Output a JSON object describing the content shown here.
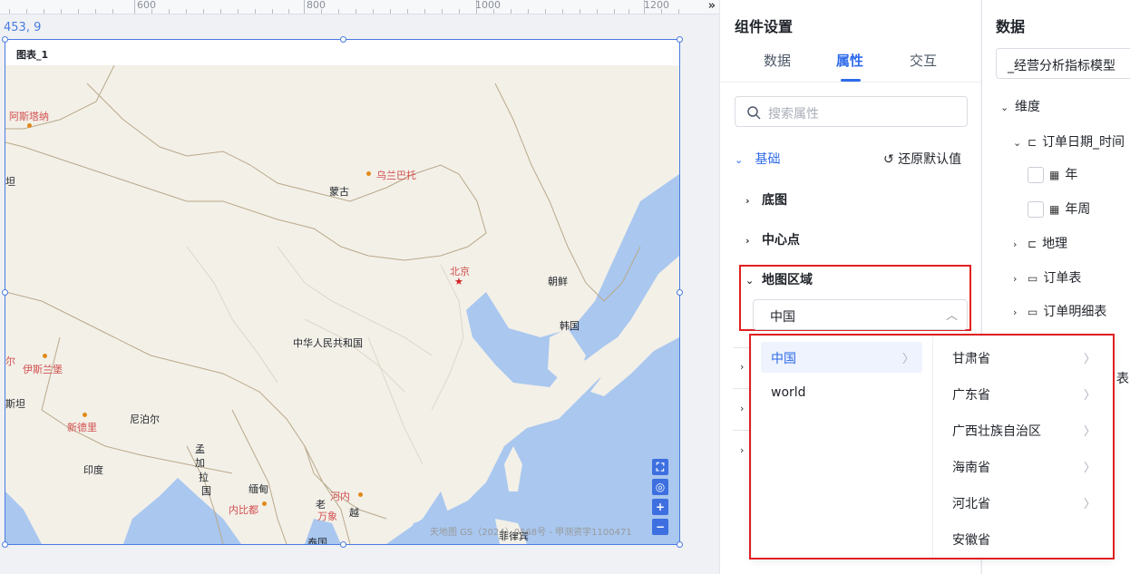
{
  "ruler": {
    "labels": [
      "600",
      "800",
      "1000",
      "1200"
    ],
    "expand_icon": "»"
  },
  "coords": "453, 9",
  "chart": {
    "title": "图表_1",
    "map_labels": {
      "asitana": "阿斯塔纳",
      "ulanbator": "乌兰巴托",
      "mongolia": "蒙古",
      "beijing": "北京",
      "pyongyang": "朝鲜",
      "korea": "韩国",
      "china": "中华人民共和国",
      "islamabad": "伊斯兰堡",
      "er": "尔",
      "stan": "斯坦",
      "newdelhi": "新德里",
      "nepal": "尼泊尔",
      "india": "印度",
      "bangla1": "孟",
      "bangla2": "加",
      "bangla3": "拉",
      "bangla4": "国",
      "myanmar": "缅甸",
      "naypyidaw": "内比都",
      "hanoi": "河内",
      "laos": "老",
      "vientiane": "万象",
      "viet": "越",
      "thailand": "泰国",
      "philippines": "菲律宾",
      "jia": "坦"
    },
    "attribution": "天地图 GS（2024）0568号 - 甲测资字1100471"
  },
  "settings": {
    "title": "组件设置",
    "tabs": [
      "数据",
      "属性",
      "交互"
    ],
    "active_tab": "属性",
    "search_placeholder": "搜索属性",
    "basic_section": "基础",
    "reset_label": "还原默认值",
    "groups": {
      "basemap": "底图",
      "center": "中心点",
      "region": "地图区域"
    },
    "region_value": "中国"
  },
  "data_panel": {
    "title": "数据",
    "model": "_经营分析指标模型",
    "dimension": "维度",
    "order_date": "订单日期_时间",
    "year": "年",
    "year_week": "年周",
    "geo": "地理",
    "order_table": "订单表",
    "order_detail": "订单明细表",
    "partial_char": "表"
  },
  "cascader": {
    "level1": [
      "中国",
      "world"
    ],
    "level1_selected": "中国",
    "level2": [
      "甘肃省",
      "广东省",
      "广西壮族自治区",
      "海南省",
      "河北省",
      "安徽省"
    ]
  },
  "colors": {
    "accent": "#2f6bea",
    "highlight_box": "#e02020",
    "selection_frame": "#4a7be0",
    "sea": "#a9c7ef",
    "land": "#f3f0e8"
  }
}
